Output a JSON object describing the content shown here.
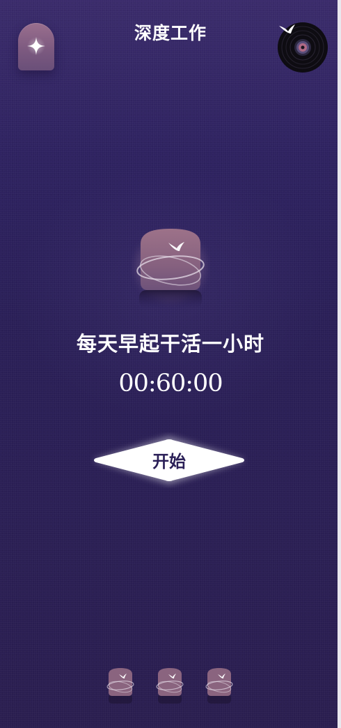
{
  "header": {
    "title": "深度工作",
    "left_icon": "sparkle-icon",
    "right_icon": "vinyl-record-icon"
  },
  "main": {
    "task_title": "每天早起干活一小时",
    "timer": "00:60:00",
    "start_label": "开始"
  },
  "options": [
    {
      "icon": "planet-bird-icon"
    },
    {
      "icon": "planet-bird-icon"
    },
    {
      "icon": "planet-bird-icon"
    }
  ],
  "colors": {
    "background": "#2b1f55",
    "card_pink": "#9a6f8e",
    "text": "#ffffff",
    "button": "#ffffff"
  }
}
